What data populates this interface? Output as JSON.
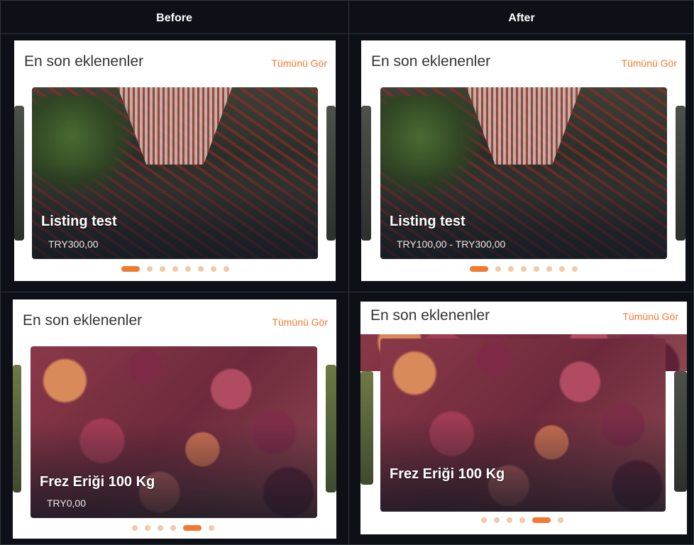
{
  "columns": {
    "before": "Before",
    "after": "After"
  },
  "panels": [
    {
      "id": "before-top",
      "title": "En son eklenenler",
      "link": "Tümünü Gör",
      "card_title": "Listing test",
      "card_price": "TRY300,00",
      "dots": 8,
      "active_dot": 0
    },
    {
      "id": "after-top",
      "title": "En son eklenenler",
      "link": "Tümünü Gör",
      "card_title": "Listing test",
      "card_price": "TRY100,00 - TRY300,00",
      "dots": 8,
      "active_dot": 0
    },
    {
      "id": "before-bottom",
      "title": "En son eklenenler",
      "link": "Tümünü Gör",
      "card_title": "Frez Eriği 100 Kg",
      "card_price": "TRY0,00",
      "dots": 6,
      "active_dot": 4
    },
    {
      "id": "after-bottom",
      "title": "En son eklenenler",
      "link": "Tümünü Gör",
      "card_title": "Frez Eriği 100 Kg",
      "card_price": "",
      "dots": 6,
      "active_dot": 4
    }
  ],
  "colors": {
    "accent": "#f07a30",
    "dot_inactive": "#f3c9a7",
    "background": "#0d1117",
    "border": "#30363d"
  }
}
